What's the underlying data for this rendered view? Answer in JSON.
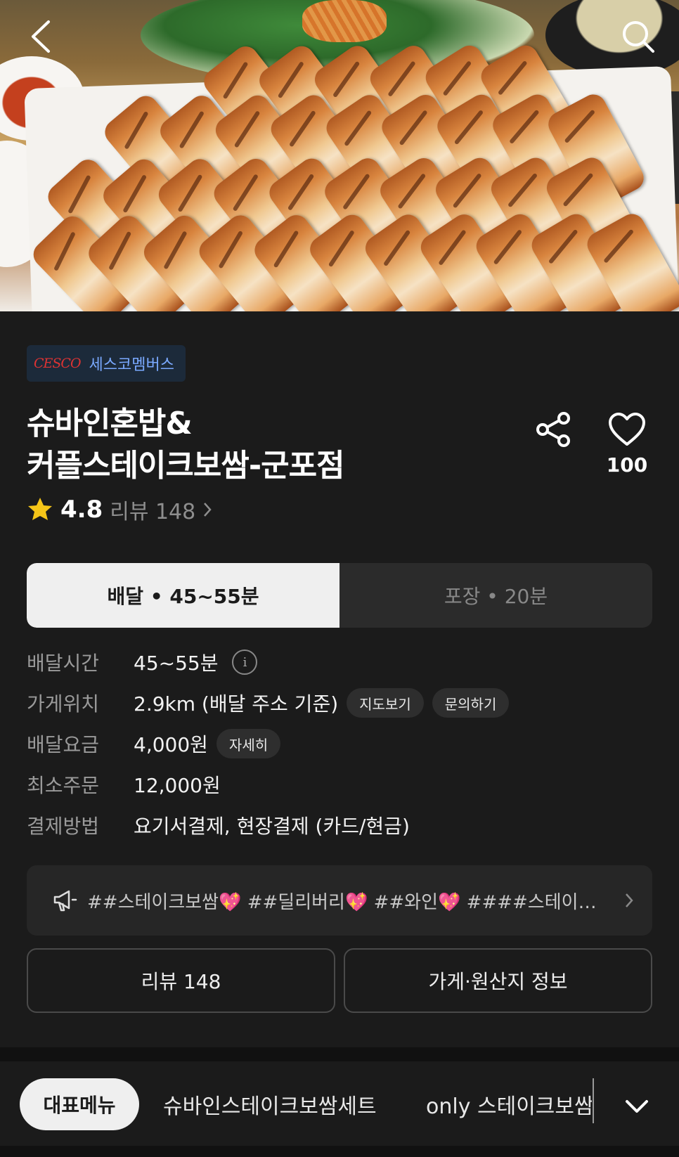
{
  "store": {
    "badge_logo": "CESCO",
    "badge_text": "세스코멤버스",
    "name_line1": "슈바인혼밥&",
    "name_line2": "커플스테이크보쌈-군포점",
    "favorite_count": "100",
    "rating": "4.8",
    "review_label": "리뷰 148"
  },
  "order_type": {
    "delivery": "배달 • 45~55분",
    "pickup": "포장 • 20분",
    "selected": "delivery"
  },
  "details": {
    "delivery_time_label": "배달시간",
    "delivery_time_value": "45~55분",
    "location_label": "가게위치",
    "location_value": "2.9km (배달 주소 기준)",
    "map_chip": "지도보기",
    "inquiry_chip": "문의하기",
    "fee_label": "배달요금",
    "fee_value": "4,000원",
    "fee_detail_chip": "자세히",
    "min_order_label": "최소주문",
    "min_order_value": "12,000원",
    "payment_label": "결제방법",
    "payment_value": "요기서결제, 현장결제 (카드/현금)"
  },
  "notice": {
    "text": "##스테이크보쌈💖 ##딜리버리💖 ##와인💖 ####스테이…"
  },
  "buttons": {
    "reviews": "리뷰 148",
    "store_info": "가게·원산지 정보"
  },
  "menu_tabs": {
    "active": "대표메뉴",
    "tab1": "슈바인스테이크보쌈세트",
    "tab2": "only 스테이크보쌈"
  },
  "colors": {
    "background": "#1b1b1b",
    "badge_bg": "#1c2a3a",
    "badge_text": "#7aa9ff",
    "star": "#f5c518"
  },
  "icons": {
    "back": "back-arrow-icon",
    "search": "search-icon",
    "share": "share-icon",
    "favorite": "heart-icon",
    "star": "star-icon",
    "info": "info-icon",
    "megaphone": "megaphone-icon",
    "expand": "chevron-down-icon"
  }
}
